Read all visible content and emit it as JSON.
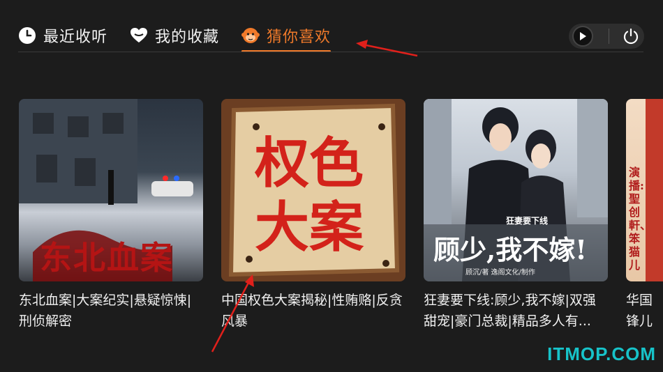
{
  "tabs": [
    {
      "label": "最近收听",
      "icon": "clock-icon"
    },
    {
      "label": "我的收藏",
      "icon": "heart-icon"
    },
    {
      "label": "猜你喜欢",
      "icon": "monkey-face-icon",
      "active": true
    }
  ],
  "controls": {
    "play_icon": "play-icon",
    "power_icon": "power-icon"
  },
  "cards": [
    {
      "title": "东北血案|大案纪实|悬疑惊悚|刑侦解密",
      "cover_text": "东北血案"
    },
    {
      "title": "中国权色大案揭秘|性贿赂|反贪风暴",
      "cover_text_1": "权色",
      "cover_text_2": "大案"
    },
    {
      "title": "狂妻要下线:顾少,我不嫁|双强甜宠|豪门总裁|精品多人有...",
      "cover_text": "顾少,我不嫁!",
      "cover_small": "狂妻要下线",
      "cover_credit": "顾沉/著  逸阁文化/制作"
    },
    {
      "title": "华国锋儿演播",
      "cover_text": "演播:聖创軒、笨猫儿"
    }
  ],
  "watermark": "ITMOP.COM",
  "colors": {
    "accent": "#f07a2a",
    "background": "#1c1c1c",
    "arrow": "#e0201b"
  }
}
